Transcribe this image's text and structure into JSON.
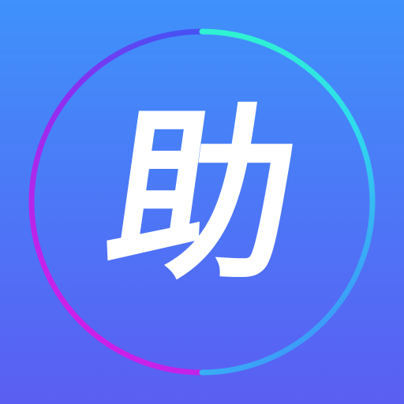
{
  "icon": {
    "name": "assistant-app-icon",
    "glyph": "助",
    "colors": {
      "background_top": "#3f8ffb",
      "background_bottom": "#5a5ff2",
      "glyph": "#ffffff",
      "ring_gradient": [
        "#2a3cf0",
        "#9b2cf0",
        "#c51fe6",
        "#3fb9ff",
        "#2df0d0",
        "#2de0e8"
      ]
    }
  }
}
